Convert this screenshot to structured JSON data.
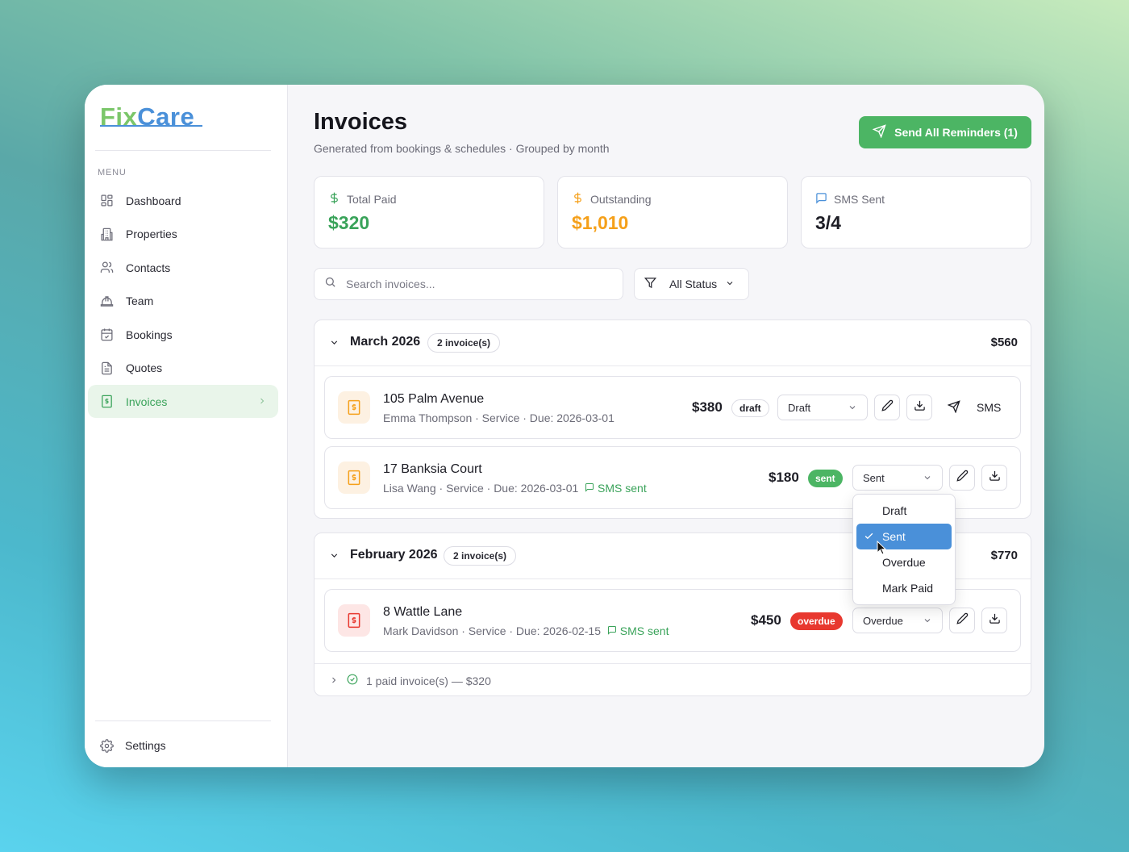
{
  "sidebar": {
    "logo_part1": "Fix",
    "logo_part2": "Care",
    "menu_label": "MENU",
    "items": [
      {
        "label": "Dashboard",
        "icon": "dashboard-icon"
      },
      {
        "label": "Properties",
        "icon": "building-icon"
      },
      {
        "label": "Contacts",
        "icon": "users-icon"
      },
      {
        "label": "Team",
        "icon": "hardhat-icon"
      },
      {
        "label": "Bookings",
        "icon": "calendar-icon"
      },
      {
        "label": "Quotes",
        "icon": "document-icon"
      },
      {
        "label": "Invoices",
        "icon": "invoice-icon",
        "active": true
      }
    ],
    "settings_label": "Settings"
  },
  "header": {
    "title": "Invoices",
    "subtitle": "Generated from bookings & schedules · Grouped by month",
    "reminder_button": "Send All Reminders (1)"
  },
  "stats": [
    {
      "label": "Total Paid",
      "value": "$320",
      "color": "#3aa35a",
      "icon": "dollar-icon"
    },
    {
      "label": "Outstanding",
      "value": "$1,010",
      "color": "#f5a01a",
      "icon": "dollar-icon"
    },
    {
      "label": "SMS Sent",
      "value": "3/4",
      "color": "#1d1d25",
      "icon": "message-icon"
    }
  ],
  "search": {
    "placeholder": "Search invoices..."
  },
  "filter": {
    "label": "All Status"
  },
  "groups": [
    {
      "title": "March 2026",
      "count": "2 invoice(s)",
      "total": "$560",
      "invoices": [
        {
          "title": "105 Palm Avenue",
          "subtitle": "Emma Thompson · Service · Due: 2026-03-01",
          "sms": "",
          "amount": "$380",
          "badge": "draft",
          "status": "Draft",
          "sms_button": "SMS"
        },
        {
          "title": "17 Banksia Court",
          "subtitle": "Lisa Wang · Service · Due: 2026-03-01",
          "sms": "SMS sent",
          "amount": "$180",
          "badge": "sent",
          "status": "Sent"
        }
      ]
    },
    {
      "title": "February 2026",
      "count": "2 invoice(s)",
      "total": "$770",
      "invoices": [
        {
          "title": "8 Wattle Lane",
          "subtitle": "Mark Davidson · Service · Due: 2026-02-15",
          "sms": "SMS sent",
          "amount": "$450",
          "badge": "overdue",
          "status": "Overdue"
        }
      ],
      "paid_summary": "1 paid invoice(s) — $320"
    }
  ],
  "dropdown": {
    "options": [
      "Draft",
      "Sent",
      "Overdue",
      "Mark Paid"
    ],
    "selected": "Sent"
  },
  "colors": {
    "accent_green": "#4cb564",
    "accent_blue": "#4a90d9",
    "overdue_red": "#e8382f",
    "outstanding_orange": "#f5a01a"
  }
}
